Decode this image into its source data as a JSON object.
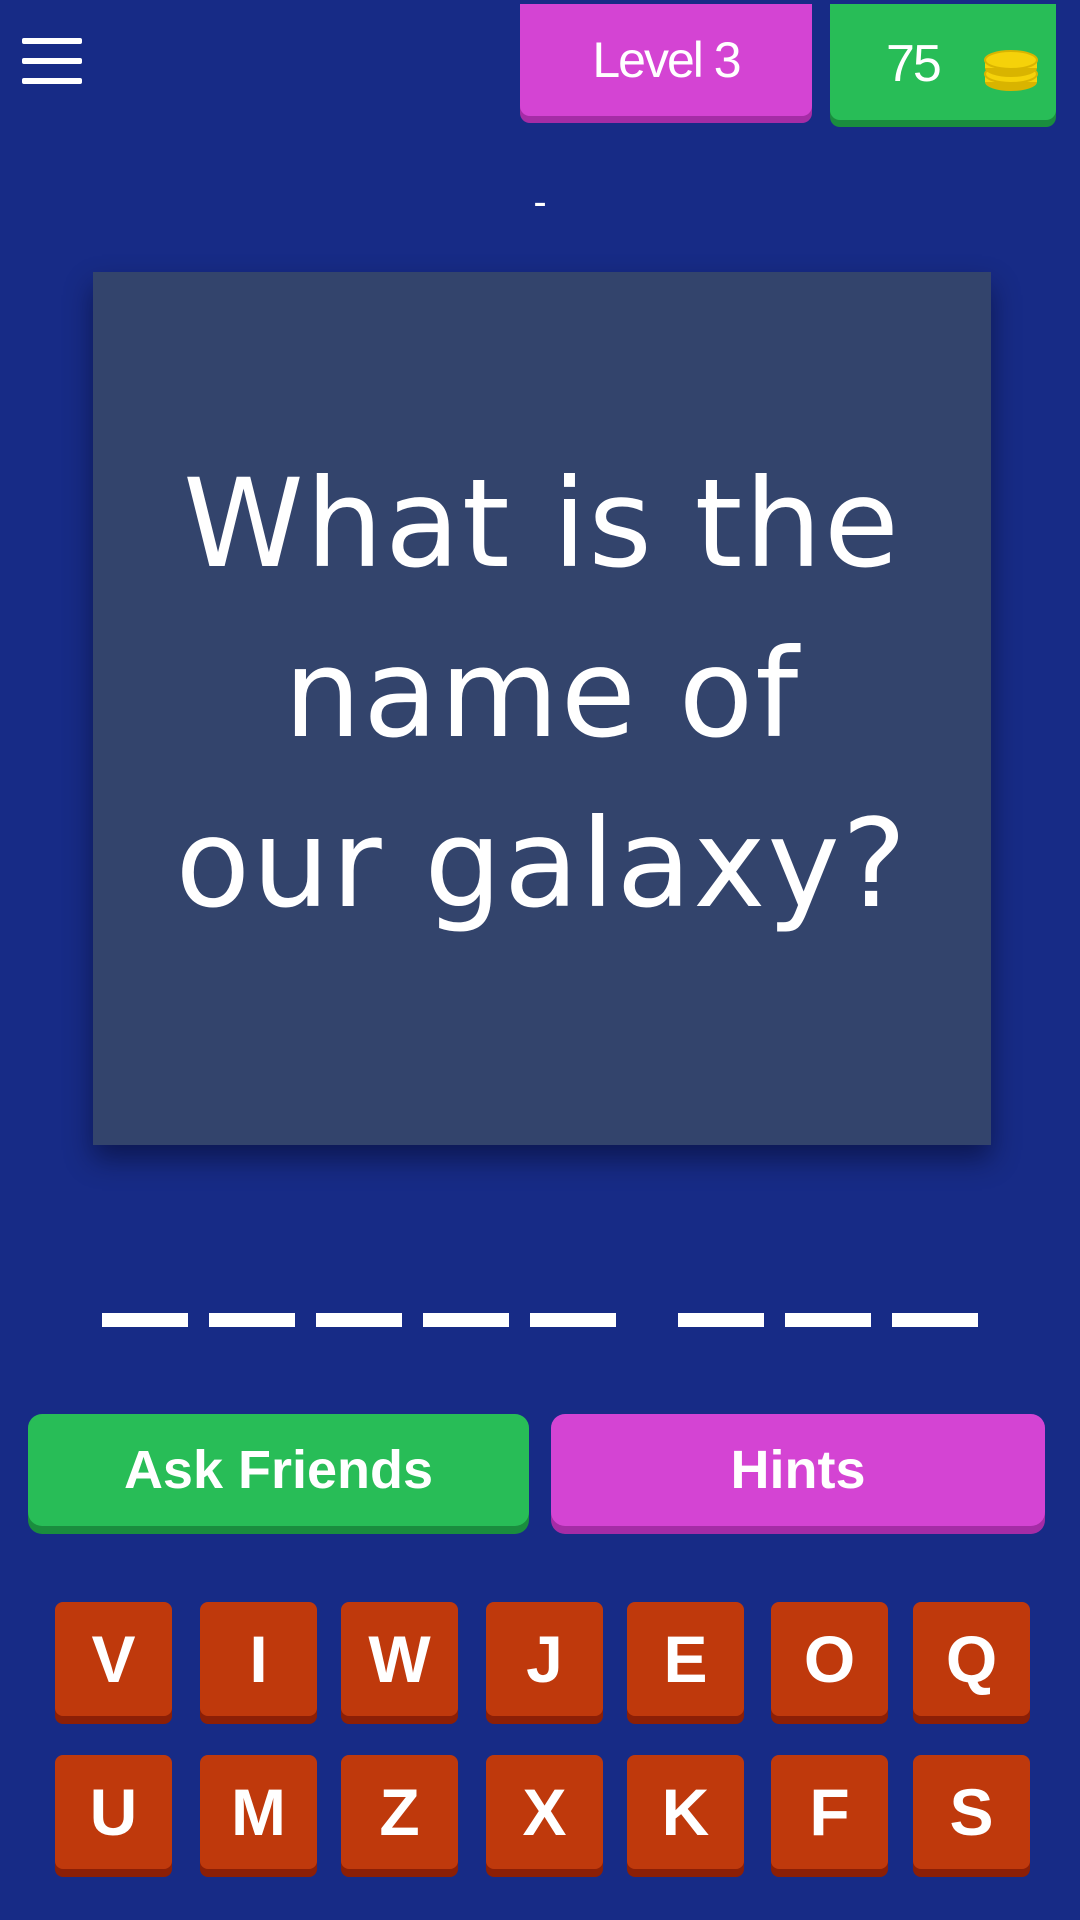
{
  "header": {
    "level_label": "Level 3",
    "coins": "75",
    "coin_icon": "coin-stack-icon",
    "menu_icon": "hamburger-menu-icon"
  },
  "subtitle": "-",
  "question": {
    "text": "What is the name of our galaxy?"
  },
  "answer": {
    "word_lengths": [
      5,
      3
    ],
    "letters": [
      "",
      "",
      "",
      "",
      "",
      "",
      "",
      ""
    ]
  },
  "buttons": {
    "ask_friends": "Ask Friends",
    "hints": "Hints"
  },
  "keyboard": {
    "rows": [
      [
        "V",
        "I",
        "W",
        "J",
        "E",
        "O",
        "Q"
      ],
      [
        "U",
        "M",
        "Z",
        "X",
        "K",
        "F",
        "S"
      ]
    ]
  },
  "colors": {
    "background": "#172b86",
    "card": "#33446c",
    "level_pill": "#d444d3",
    "coins_pill": "#28bd57",
    "ask_friends": "#28bd57",
    "hints": "#d444d3",
    "key": "#bf390c",
    "coin": "#f5d20a"
  }
}
